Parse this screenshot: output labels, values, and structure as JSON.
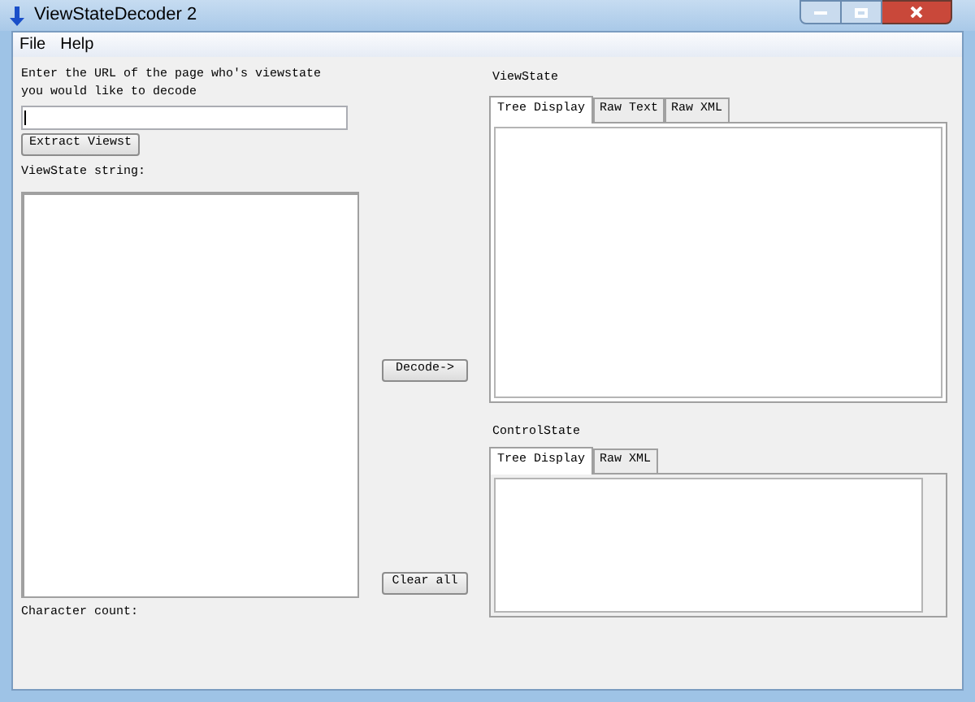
{
  "window": {
    "title": "ViewStateDecoder 2"
  },
  "menu": [
    "File",
    "Help"
  ],
  "url_prompt": "Enter the URL of the page who's viewstate you would like to decode",
  "extract_button": "Extract Viewst",
  "viewstate_string_label": "ViewState string:",
  "character_count_label": "Character count:",
  "decode_button": "Decode->",
  "clear_button": "Clear all",
  "viewstate": {
    "label": "ViewState",
    "tabs": [
      {
        "label": "Tree Display",
        "selected": true
      },
      {
        "label": "Raw Text",
        "selected": false
      },
      {
        "label": "Raw XML",
        "selected": false
      }
    ]
  },
  "controlstate": {
    "label": "ControlState",
    "tabs": [
      {
        "label": "Tree Display",
        "selected": true
      },
      {
        "label": "Raw XML",
        "selected": false
      }
    ]
  }
}
